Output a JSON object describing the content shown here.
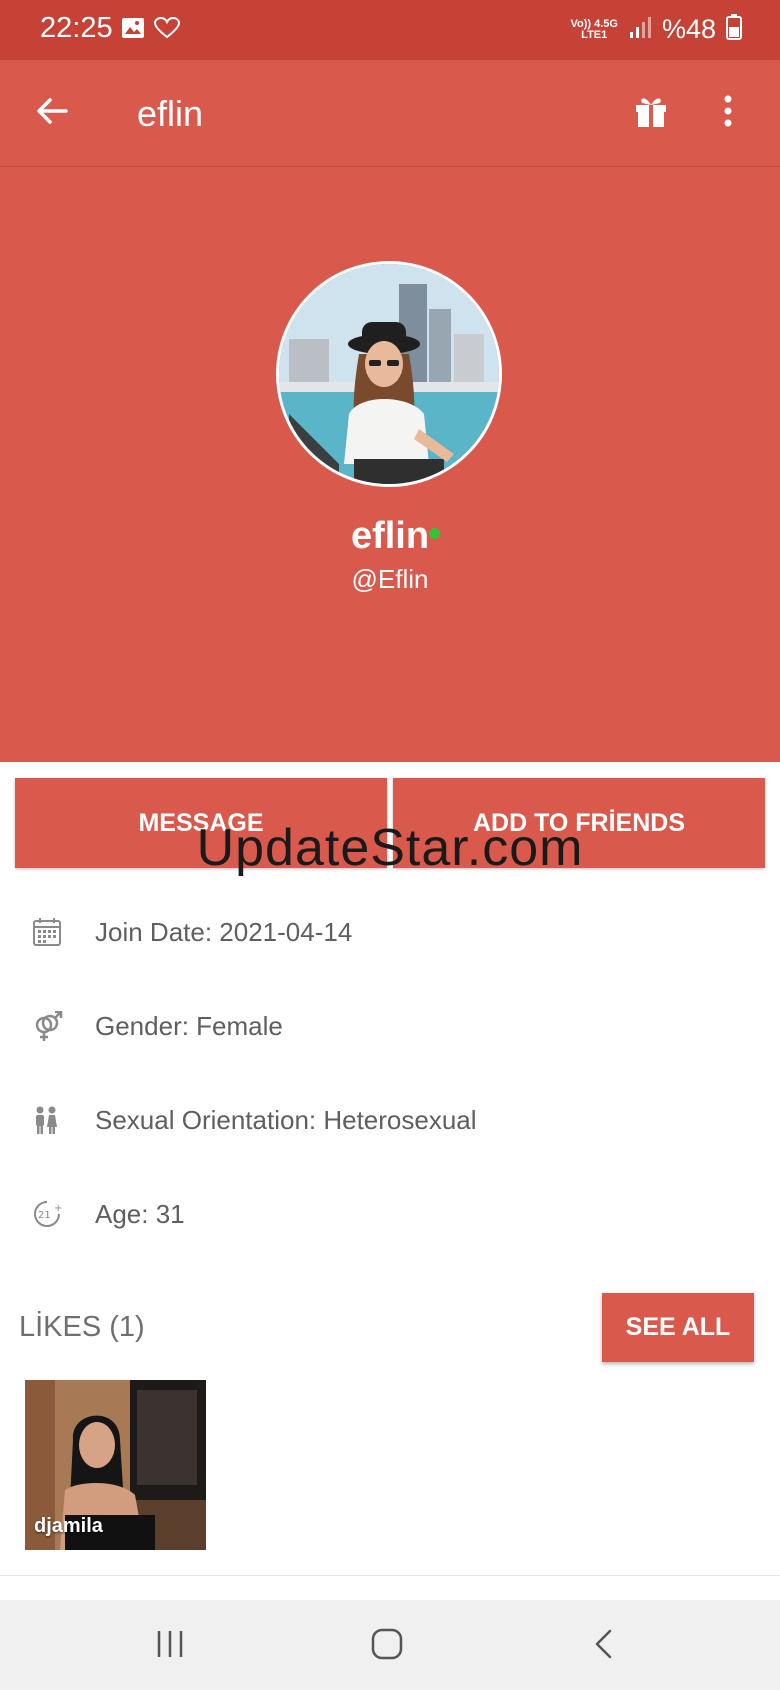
{
  "status_bar": {
    "time": "22:25",
    "network_top": "Vo)) 4.5G",
    "network_bottom": "LTE1",
    "battery": "%48"
  },
  "app_bar": {
    "title": "eflin"
  },
  "profile": {
    "name": "eflin",
    "username": "@Eflin",
    "online_color": "#33c23a"
  },
  "actions": {
    "message_label": "MESSAGE",
    "add_friends_label": "ADD TO FRİENDS"
  },
  "watermark": "UpdateStar.com",
  "info": [
    {
      "icon": "calendar-icon",
      "text": "Join Date: 2021-04-14"
    },
    {
      "icon": "gender-icon",
      "text": "Gender: Female"
    },
    {
      "icon": "couple-icon",
      "text": "Sexual Orientation: Heterosexual"
    },
    {
      "icon": "age-21-icon",
      "text": "Age: 31"
    }
  ],
  "likes": {
    "header": "LİKES (1)",
    "see_all_label": "SEE ALL",
    "items": [
      {
        "name": "djamila"
      }
    ]
  },
  "colors": {
    "accent": "#d95a4c",
    "status_bar": "#c74236"
  }
}
